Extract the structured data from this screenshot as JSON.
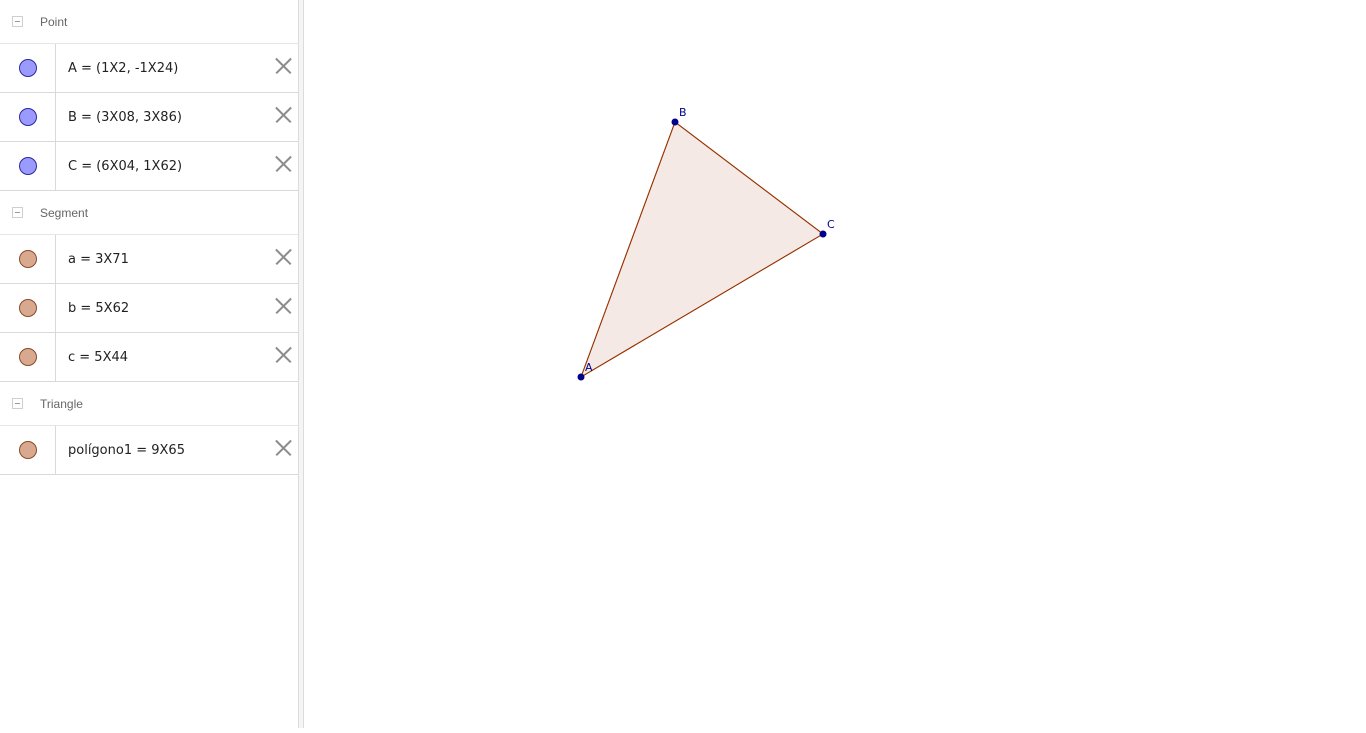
{
  "algebra": {
    "groups": [
      {
        "label": "Point",
        "items": [
          {
            "text": "A = (1X2, -1X24)",
            "color": "#9a9aff"
          },
          {
            "text": "B = (3X08, 3X86)",
            "color": "#9a9aff"
          },
          {
            "text": "C = (6X04, 1X62)",
            "color": "#9a9aff"
          }
        ]
      },
      {
        "label": "Segment",
        "items": [
          {
            "text": "a = 3X71",
            "color": "#d9a98f"
          },
          {
            "text": "b = 5X62",
            "color": "#d9a98f"
          },
          {
            "text": "c = 5X44",
            "color": "#d9a98f"
          }
        ]
      },
      {
        "label": "Triangle",
        "items": [
          {
            "text": "polígono1 = 9X65",
            "color": "#d9a98f"
          }
        ]
      }
    ]
  },
  "graphics": {
    "point_labels": {
      "A": "A",
      "B": "B",
      "C": "C"
    },
    "point_color": "#00008b",
    "polygon_stroke": "#993300",
    "polygon_fill": "#f4e9e4"
  }
}
